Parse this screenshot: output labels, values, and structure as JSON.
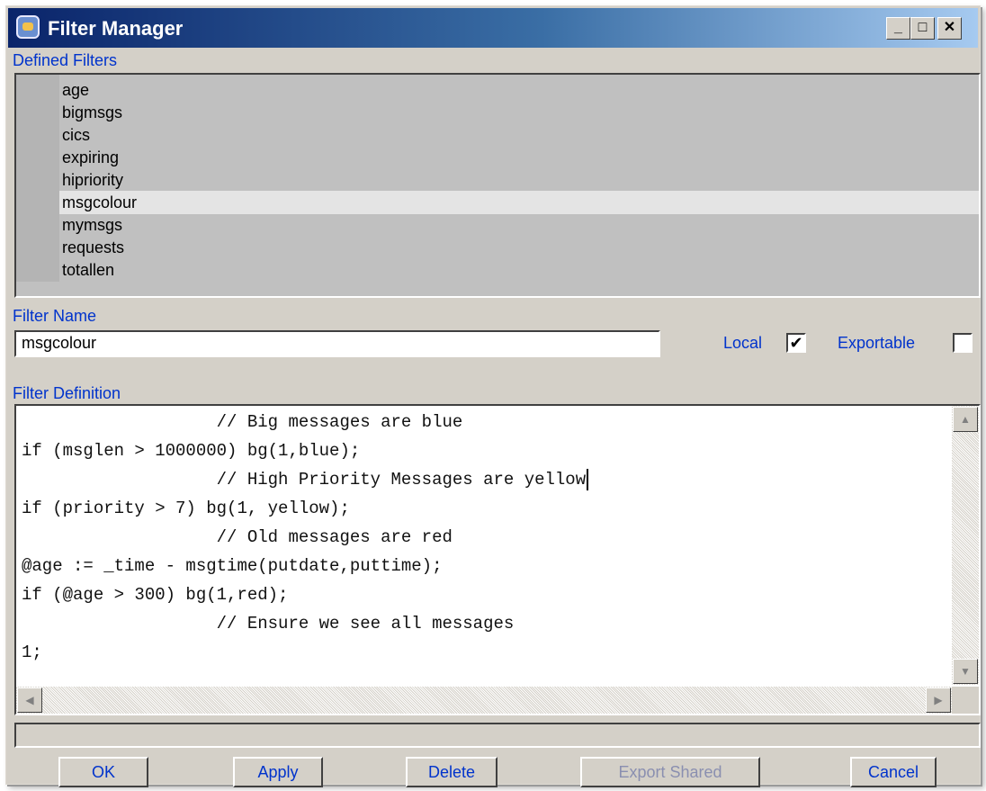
{
  "window": {
    "title": "Filter Manager",
    "controls": {
      "minimize": "_",
      "maximize": "□",
      "close": "✕"
    }
  },
  "defined_filters": {
    "label": "Defined Filters",
    "items": [
      "age",
      "bigmsgs",
      "cics",
      "expiring",
      "hipriority",
      "msgcolour",
      "mymsgs",
      "requests",
      "totallen"
    ],
    "selected": "msgcolour"
  },
  "filter_name": {
    "label": "Filter Name",
    "value": "msgcolour"
  },
  "options": {
    "local_label": "Local",
    "local_checked": true,
    "local_mark": "✔",
    "exportable_label": "Exportable",
    "exportable_checked": false,
    "exportable_mark": ""
  },
  "filter_definition": {
    "label": "Filter Definition",
    "lines": [
      "                   // Big messages are blue",
      "if (msglen > 1000000) bg(1,blue);",
      "                   // High Priority Messages are yellow",
      "if (priority > 7) bg(1, yellow);",
      "                   // Old messages are red",
      "@age := _time - msgtime(putdate,puttime);",
      "if (@age > 300) bg(1,red);",
      "                   // Ensure we see all messages",
      "1;"
    ]
  },
  "buttons": {
    "ok": "OK",
    "apply": "Apply",
    "delete": "Delete",
    "export_shared": "Export Shared",
    "cancel": "Cancel"
  },
  "colors": {
    "title_gradient_start": "#0a246a",
    "title_gradient_end": "#a6caf0",
    "label_blue": "#0033cc",
    "window_face": "#d4d0c8",
    "list_background": "#c0c0c0",
    "selected_row": "#e4e4e4"
  }
}
